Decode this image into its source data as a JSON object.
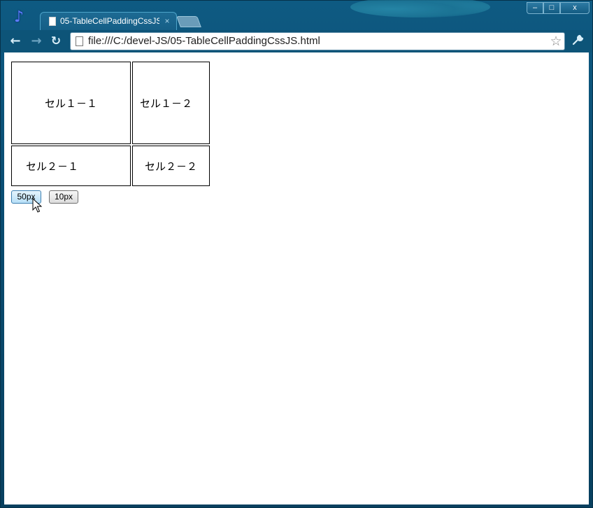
{
  "browser": {
    "tab_title": "05-TableCellPaddingCssJS",
    "tab_close": "×",
    "url": "file:///C:/devel-JS/05-TableCellPaddingCssJS.html",
    "window_buttons": {
      "minimize": "–",
      "maximize": "□",
      "close": "x"
    },
    "nav": {
      "back": "←",
      "forward": "→",
      "reload": "↻"
    },
    "star": "☆",
    "wrench": "🔧",
    "app_icon": "♪"
  },
  "table": {
    "cells": [
      [
        "セル１－１",
        "セル１－２"
      ],
      [
        "セル２－１",
        "セル２－２"
      ]
    ]
  },
  "buttons": {
    "padding_50": "50px",
    "padding_10": "10px"
  }
}
